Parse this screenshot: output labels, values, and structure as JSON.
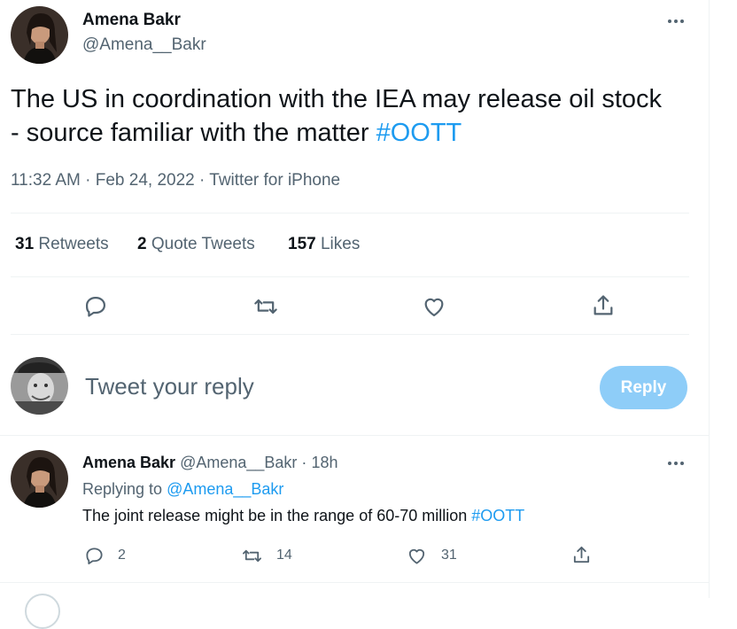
{
  "colors": {
    "accent": "#1d9bf0",
    "muted": "#536471",
    "reply_button_disabled": "#8ecdf8"
  },
  "tweet": {
    "author_name": "Amena Bakr",
    "author_handle": "@Amena__Bakr",
    "text_main": "The US in coordination with the IEA may release oil stock - source familiar with the matter",
    "hashtag": "#OOTT",
    "timestamp": "11:32 AM · Feb 24, 2022 · Twitter for iPhone",
    "stats": {
      "retweets_count": "31",
      "retweets_label": "Retweets",
      "quotes_count": "2",
      "quotes_label": "Quote Tweets",
      "likes_count": "157",
      "likes_label": "Likes"
    },
    "actions": [
      "reply-icon",
      "retweet-icon",
      "like-icon",
      "share-icon"
    ]
  },
  "composer": {
    "placeholder": "Tweet your reply",
    "reply_button": "Reply"
  },
  "reply": {
    "author_name": "Amena Bakr",
    "author_handle": "@Amena__Bakr",
    "time": "18h",
    "replying_to_label": "Replying to",
    "replying_to_handle": "@Amena__Bakr",
    "text_main": "The joint release might be in the range of 60-70 million",
    "hashtag": "#OOTT",
    "counts": {
      "replies": "2",
      "retweets": "14",
      "likes": "31"
    }
  }
}
